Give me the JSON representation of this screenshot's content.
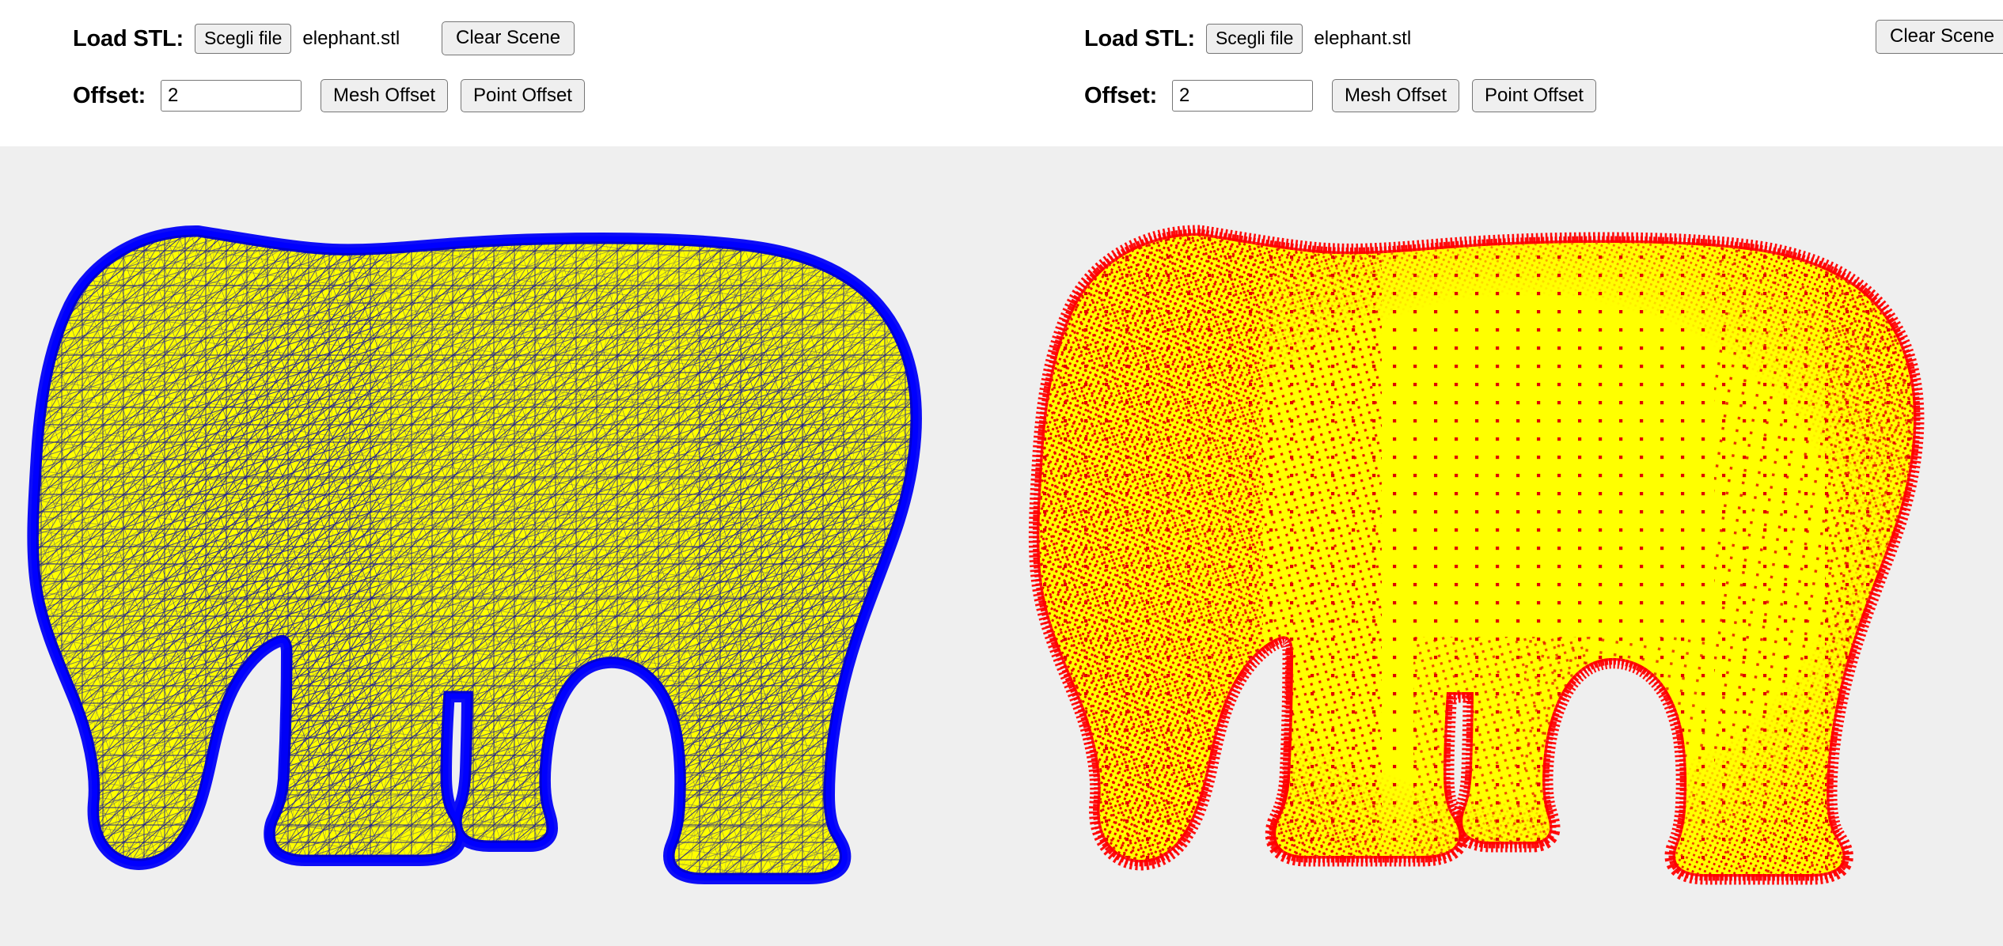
{
  "app": {
    "background_color": "#efefef",
    "header_background": "#ffffff"
  },
  "panels": [
    {
      "id": "left",
      "controls": {
        "load_label": "Load STL:",
        "file_button_label": "Scegli file",
        "file_name": "elephant.stl",
        "clear_scene_label": "Clear Scene",
        "offset_label": "Offset:",
        "offset_value": "2",
        "offset_placeholder": "",
        "mesh_offset_label": "Mesh Offset",
        "point_offset_label": "Point Offset"
      },
      "viewer": {
        "render_mode": "mesh-wireframe",
        "model": "elephant",
        "surface_color": "#ffff00",
        "wire_color": "#0000ee",
        "offset_shell_color": "#0000ff",
        "background_color": "#efefef"
      }
    },
    {
      "id": "right",
      "controls": {
        "load_label": "Load STL:",
        "file_button_label": "Scegli file",
        "file_name": "elephant.stl",
        "clear_scene_label": "Clear Scene",
        "offset_label": "Offset:",
        "offset_value": "2",
        "offset_placeholder": "",
        "mesh_offset_label": "Mesh Offset",
        "point_offset_label": "Point Offset"
      },
      "viewer": {
        "render_mode": "point-cloud",
        "model": "elephant",
        "surface_color": "#ffff00",
        "point_color": "#ee0000",
        "offset_shell_color": "#ff0000",
        "background_color": "#efefef"
      }
    }
  ]
}
